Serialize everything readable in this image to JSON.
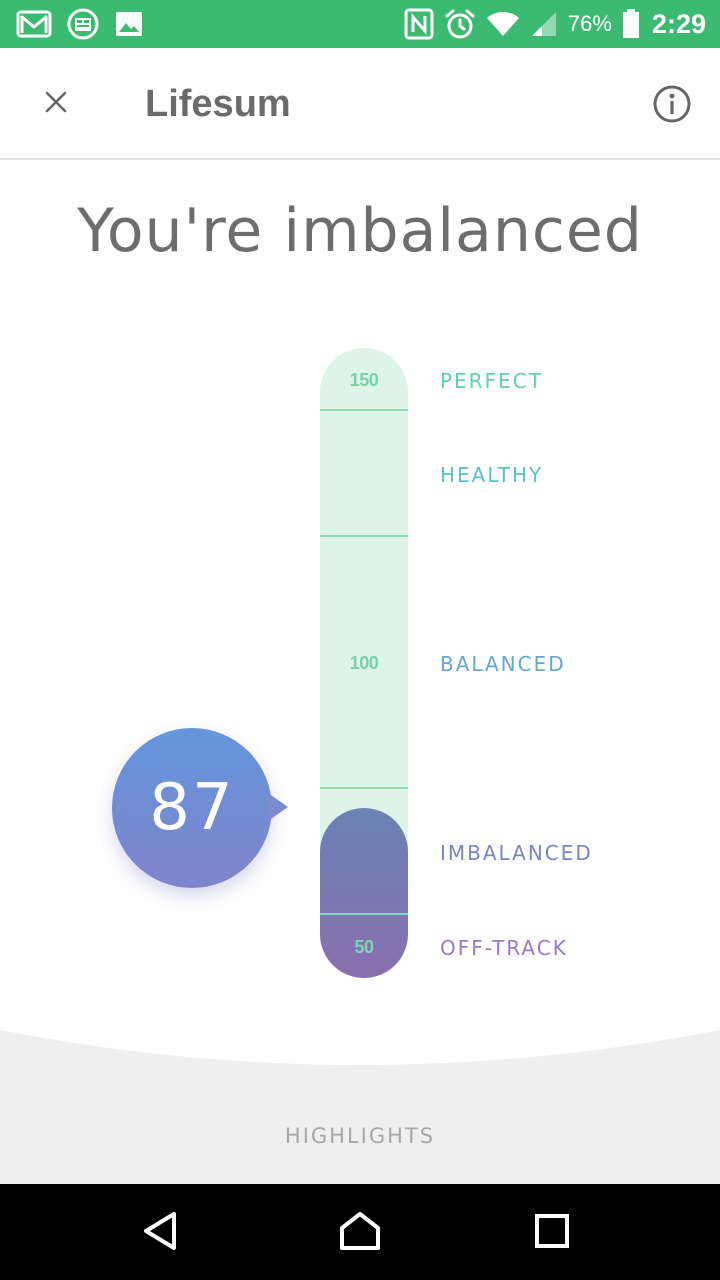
{
  "status_bar": {
    "battery_percent": "76%",
    "time": "2:29",
    "left_icons": [
      "gmail-icon",
      "sense-icon",
      "gallery-icon"
    ],
    "right_icons": [
      "nfc-icon",
      "alarm-icon",
      "wifi-icon",
      "signal-icon",
      "battery-icon"
    ],
    "background_color": "#3dba72"
  },
  "header": {
    "title": "Lifesum",
    "close_icon": "close-icon",
    "info_icon": "info-icon"
  },
  "main": {
    "status_title": "You're imbalanced",
    "meter": {
      "tick_labels": {
        "top": "150",
        "middle": "100",
        "bottom": "50"
      },
      "levels": [
        "PERFECT",
        "HEALTHY",
        "BALANCED",
        "IMBALANCED",
        "OFF-TRACK"
      ],
      "level_colors": [
        "#5fd1b0",
        "#5ac2c8",
        "#64a8d0",
        "#7a84c4",
        "#9a79c0"
      ],
      "score": "87"
    }
  },
  "highlights": {
    "label": "HIGHLIGHTS"
  },
  "nav_bar": {
    "back_icon": "back-triangle-icon",
    "home_icon": "home-icon",
    "recents_icon": "recents-square-icon"
  }
}
